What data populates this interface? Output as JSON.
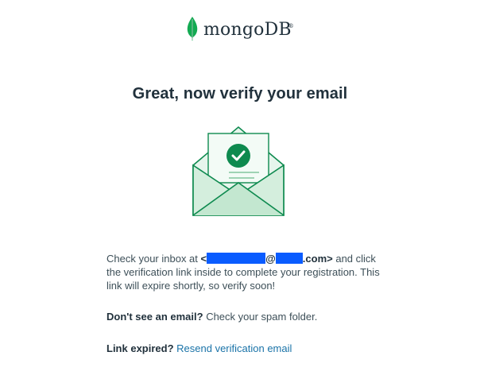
{
  "brand": {
    "name": "mongoDB",
    "registered_mark": "®",
    "leaf_color": "#13aa52"
  },
  "title": "Great, now verify your email",
  "illustration": {
    "icon": "envelope-check-icon",
    "accent": "#0e8a4f",
    "fill": "#e3f4ea"
  },
  "message": {
    "prefix": "Check your inbox at ",
    "email_open": "<",
    "email_at": "@",
    "email_suffix": ".com>",
    "continuation": " and click the verification link inside to complete your registration. This link will expire shortly, so verify soon!"
  },
  "spam_note": {
    "bold": "Don't see an email?",
    "text": " Check your spam folder."
  },
  "expired_note": {
    "bold": "Link expired?",
    "link": "Resend verification email"
  }
}
